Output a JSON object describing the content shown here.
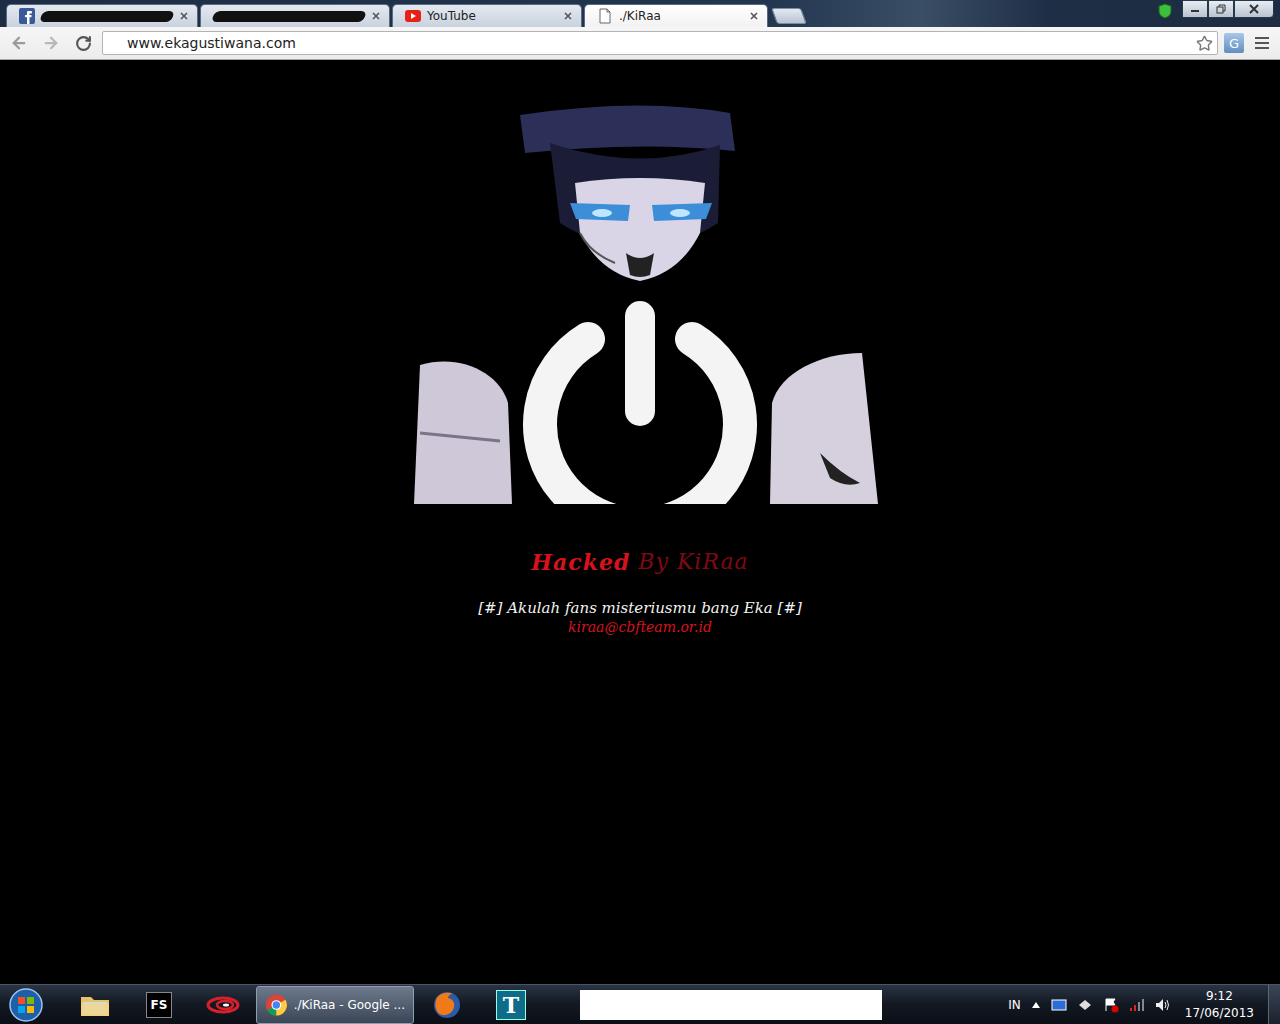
{
  "window": {
    "title": "./KiRaa"
  },
  "tabs": [
    {
      "kind": "facebook",
      "redacted": true,
      "selected": false
    },
    {
      "kind": "none",
      "redacted": true,
      "selected": false
    },
    {
      "kind": "youtube",
      "label": "YouTube",
      "redacted": false,
      "selected": false
    },
    {
      "kind": "page",
      "label": "./KiRaa",
      "redacted": false,
      "selected": true
    }
  ],
  "address_bar": {
    "url": "www.ekagustiwana.com"
  },
  "extension": {
    "label": "G"
  },
  "page": {
    "heading_main": "Hacked",
    "heading_rest": "By KiRaa",
    "message": "[#] Akulah fans misteriusmu bang Eka [#]",
    "email": "kiraa@cbfteam.or.id"
  },
  "taskbar": {
    "items": [
      {
        "kind": "explorer",
        "selected": false
      },
      {
        "kind": "fs",
        "label": "FS",
        "selected": false
      },
      {
        "kind": "swirl",
        "selected": false
      },
      {
        "kind": "chrome",
        "label": "./KiRaa - Google ...",
        "selected": true
      },
      {
        "kind": "firefox",
        "selected": false
      },
      {
        "kind": "teamviewer",
        "label": "T",
        "selected": false
      }
    ],
    "tray": {
      "language": "IN",
      "time": "9:12",
      "date": "17/06/2013"
    }
  }
}
